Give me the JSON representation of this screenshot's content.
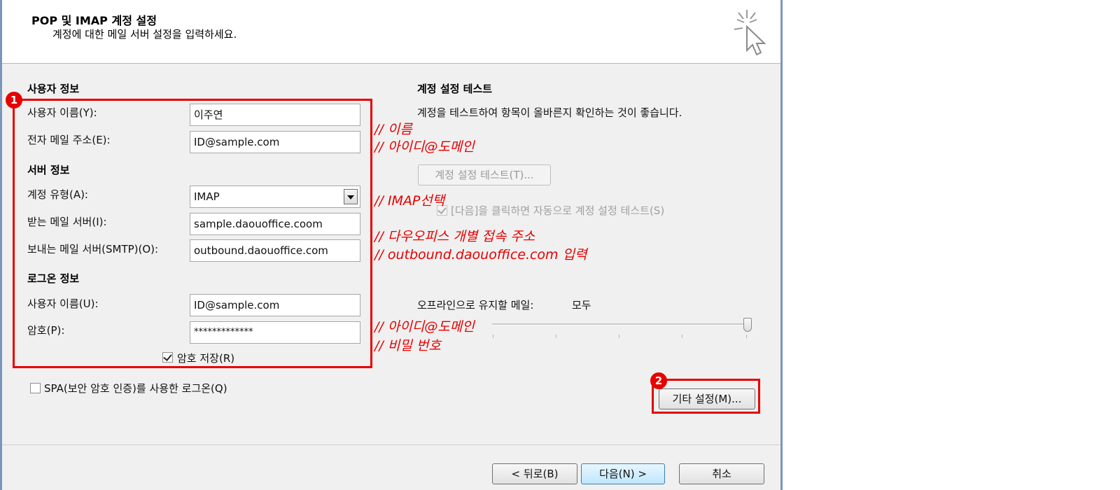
{
  "header": {
    "title": "POP 및 IMAP 계정 설정",
    "subtitle": "계정에 대한 메일 서버 설정을 입력하세요."
  },
  "user_info": {
    "section_label": "사용자 정보",
    "name_label": "사용자 이름(Y):",
    "name_value": "이주연",
    "email_label": "전자 메일 주소(E):",
    "email_value": "ID@sample.com"
  },
  "server_info": {
    "section_label": "서버 정보",
    "account_type_label": "계정 유형(A):",
    "account_type_value": "IMAP",
    "incoming_label": "받는 메일 서버(I):",
    "incoming_value": "sample.daouoffice.coom",
    "outgoing_label": "보내는 메일 서버(SMTP)(O):",
    "outgoing_value": "outbound.daouoffice.com"
  },
  "logon_info": {
    "section_label": "로그온 정보",
    "username_label": "사용자 이름(U):",
    "username_value": "ID@sample.com",
    "password_label": "암호(P):",
    "password_value": "*************",
    "remember_label": "암호 저장(R)",
    "remember_checked": true
  },
  "spa": {
    "label": "SPA(보안 암호 인증)를 사용한 로그온(Q)",
    "checked": false
  },
  "test": {
    "section_label": "계정 설정 테스트",
    "description": "계정을 테스트하여 항목이 올바른지 확인하는 것이 좋습니다.",
    "button_label": "계정 설정 테스트(T)...",
    "auto_test_label": "[다음]을 클릭하면 자동으로 계정 설정 테스트(S)",
    "auto_test_checked": true
  },
  "offline": {
    "label": "오프라인으로 유지할 메일:",
    "value": "모두",
    "slider_level": 1.0
  },
  "more_settings_label": "기타 설정(M)...",
  "footer": {
    "back_label": "< 뒤로(B)",
    "next_label": "다음(N) >",
    "cancel_label": "취소"
  },
  "annotations": {
    "badge1": "1",
    "badge2": "2",
    "note_name": "// 이름",
    "note_email": "// 아이디@도메인",
    "note_imap": "// IMAP선택",
    "note_incoming": "// 다우오피스 개별 접속 주소",
    "note_outgoing": "// outbound.daouoffice.com 입력",
    "note_username": "// 아이디@도메인",
    "note_password": "// 비밀 번호"
  },
  "colors": {
    "annotation_red": "#e60000",
    "window_border": "#7a96bd",
    "dialog_bg": "#f0f0f0"
  }
}
